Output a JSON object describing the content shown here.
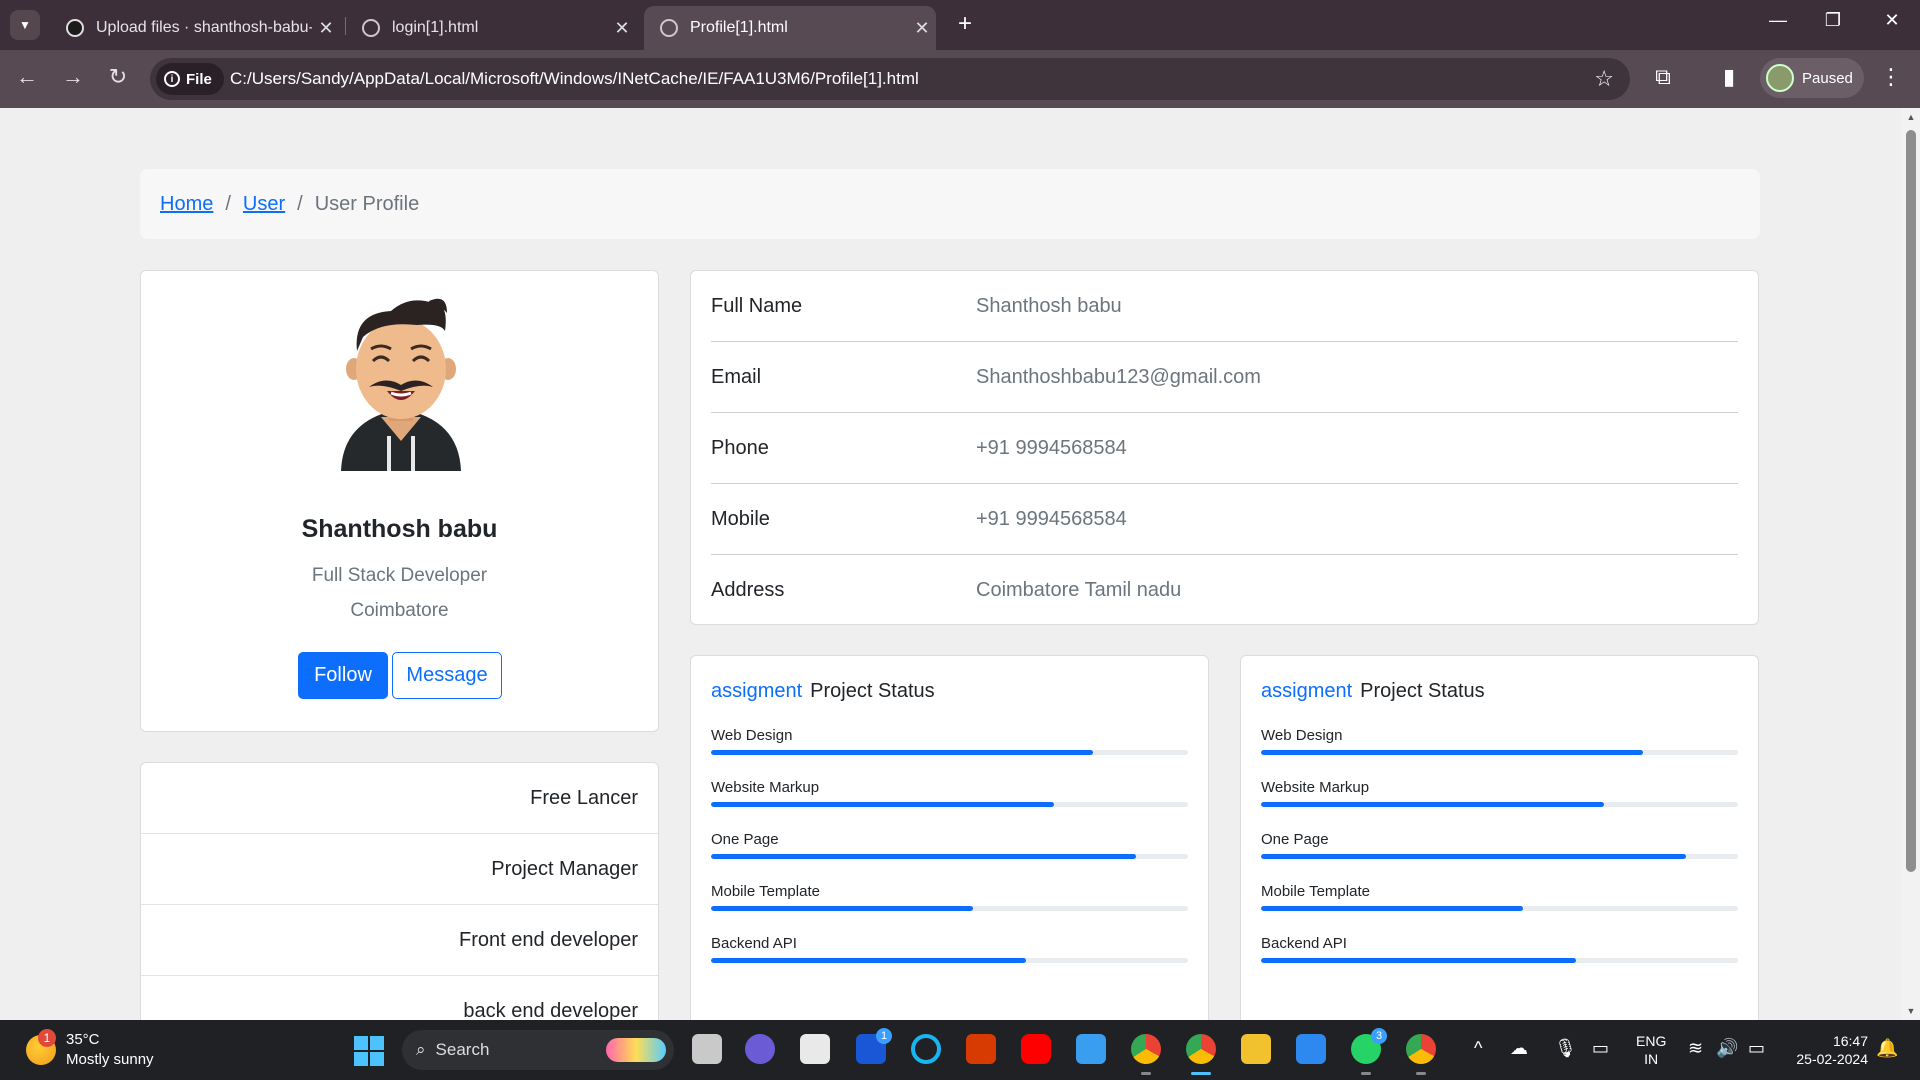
{
  "browser": {
    "tabs": [
      {
        "title": "Upload files · shanthosh-babu-l",
        "active": false
      },
      {
        "title": "login[1].html",
        "active": false
      },
      {
        "title": "Profile[1].html",
        "active": true
      }
    ],
    "new_tab": "+",
    "address": {
      "scheme_chip": "File",
      "url": "C:/Users/Sandy/AppData/Local/Microsoft/Windows/INetCache/IE/FAA1U3M6/Profile[1].html"
    },
    "profile_status": "Paused"
  },
  "breadcrumb": {
    "items": [
      {
        "label": "Home",
        "link": true
      },
      {
        "label": "User",
        "link": true
      },
      {
        "label": "User Profile",
        "link": false
      }
    ],
    "separator": "/"
  },
  "profile": {
    "name": "Shanthosh babu",
    "role": "Full Stack Developer",
    "city": "Coimbatore",
    "follow_label": "Follow",
    "message_label": "Message"
  },
  "roles": [
    "Free Lancer",
    "Project Manager",
    "Front end developer",
    "back end developer"
  ],
  "details": [
    {
      "label": "Full Name",
      "value": "Shanthosh babu"
    },
    {
      "label": "Email",
      "value": "Shanthoshbabu123@gmail.com"
    },
    {
      "label": "Phone",
      "value": "+91 9994568584"
    },
    {
      "label": "Mobile",
      "value": "+91 9994568584"
    },
    {
      "label": "Address",
      "value": "Coimbatore Tamil nadu"
    }
  ],
  "status_cards": [
    {
      "accent": "assigment",
      "title": "Project Status",
      "skills": [
        {
          "label": "Web Design",
          "percent": 80
        },
        {
          "label": "Website Markup",
          "percent": 72
        },
        {
          "label": "One Page",
          "percent": 89
        },
        {
          "label": "Mobile Template",
          "percent": 55
        },
        {
          "label": "Backend API",
          "percent": 66
        }
      ]
    },
    {
      "accent": "assigment",
      "title": "Project Status",
      "skills": [
        {
          "label": "Web Design",
          "percent": 80
        },
        {
          "label": "Website Markup",
          "percent": 72
        },
        {
          "label": "One Page",
          "percent": 89
        },
        {
          "label": "Mobile Template",
          "percent": 55
        },
        {
          "label": "Backend API",
          "percent": 66
        }
      ]
    }
  ],
  "taskbar": {
    "weather_temp": "35°C",
    "weather_desc": "Mostly sunny",
    "weather_badge": "1",
    "search_label": "Search",
    "lang_top": "ENG",
    "lang_bottom": "IN",
    "time": "16:47",
    "date": "25-02-2024",
    "badge_l": "1",
    "badge_whatsapp": "3"
  },
  "colors": {
    "accent": "#0d6efd",
    "chrome_dark": "#3c2f3a",
    "chrome_bar": "#574a52",
    "page_bg": "#efeff0"
  }
}
